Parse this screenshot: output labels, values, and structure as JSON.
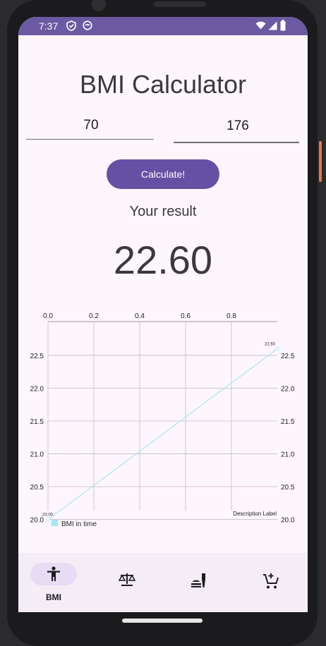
{
  "status_bar": {
    "time": "7:37"
  },
  "app": {
    "title": "BMI Calculator"
  },
  "form": {
    "weight_value": "70",
    "height_value": "176",
    "calculate_label": "Calculate!"
  },
  "result": {
    "label": "Your result",
    "value": "22.60"
  },
  "chart_data": {
    "type": "line",
    "series": [
      {
        "name": "BMI in time",
        "x": [
          0.0,
          1.0
        ],
        "values": [
          20.0,
          22.6
        ],
        "color": "#a6e6f4"
      }
    ],
    "x_ticks": [
      "0.0",
      "0.2",
      "0.4",
      "0.6",
      "0.8"
    ],
    "y_ticks": [
      "20.0",
      "20.5",
      "21.0",
      "21.5",
      "22.0",
      "22.5"
    ],
    "point_labels": [
      "20.00",
      "22.60"
    ],
    "xlim": [
      0,
      1.0
    ],
    "ylim": [
      19.9,
      22.8
    ],
    "description": "Description Label",
    "legend": {
      "label": "BMI in time",
      "position": "bottom-left"
    },
    "grid": true
  },
  "bottom_nav": {
    "items": [
      {
        "label": "BMI",
        "icon": "accessibility-icon",
        "active": true
      },
      {
        "label": "",
        "icon": "scale-icon"
      },
      {
        "label": "",
        "icon": "lunch-dining-icon"
      },
      {
        "label": "",
        "icon": "add-shopping-cart-icon"
      }
    ]
  },
  "colors": {
    "accent": "#6650a4",
    "status_bar": "#6b5aa2",
    "line": "#a6e6f4",
    "background": "#fdf7fd"
  }
}
